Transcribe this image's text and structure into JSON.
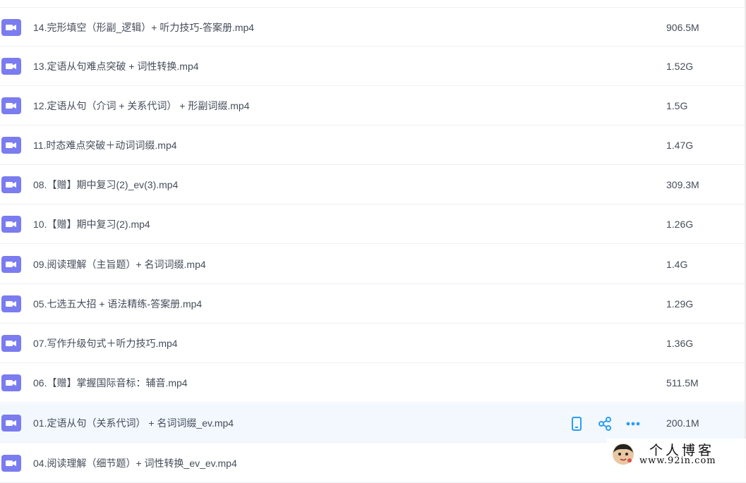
{
  "colors": {
    "video_icon": "#7a7cf0",
    "action_icon": "#2a9df4",
    "text": "#454d5a",
    "hover_row": "#f3f8ff"
  },
  "icons": {
    "file_type": "video-file-icon",
    "actions": [
      "phone-icon",
      "share-icon",
      "more-icon"
    ]
  },
  "files": [
    {
      "name": "14.完形填空（形副_逻辑）+ 听力技巧-答案册.mp4",
      "size": "906.5M"
    },
    {
      "name": "13.定语从句难点突破 + 词性转换.mp4",
      "size": "1.52G"
    },
    {
      "name": "12.定语从句（介词 + 关系代词） + 形副词缀.mp4",
      "size": "1.5G"
    },
    {
      "name": "11.时态难点突破＋动词词缀.mp4",
      "size": "1.47G"
    },
    {
      "name": "08.【赠】期中复习(2)_ev(3).mp4",
      "size": "309.3M"
    },
    {
      "name": "10.【赠】期中复习(2).mp4",
      "size": "1.26G"
    },
    {
      "name": "09.阅读理解（主旨题）+ 名词词缀.mp4",
      "size": "1.4G"
    },
    {
      "name": "05.七选五大招 + 语法精练-答案册.mp4",
      "size": "1.29G"
    },
    {
      "name": "07.写作升级句式＋听力技巧.mp4",
      "size": "1.36G"
    },
    {
      "name": "06.【赠】掌握国际音标：辅音.mp4",
      "size": "511.5M"
    },
    {
      "name": "01.定语从句（关系代词） + 名词词缀_ev.mp4",
      "size": "200.1M"
    },
    {
      "name": "04.阅读理解（细节题）+ 词性转换_ev_ev.mp4",
      "size": ""
    }
  ],
  "watermark": {
    "title": "个人博客",
    "url": "www.92in.com"
  }
}
